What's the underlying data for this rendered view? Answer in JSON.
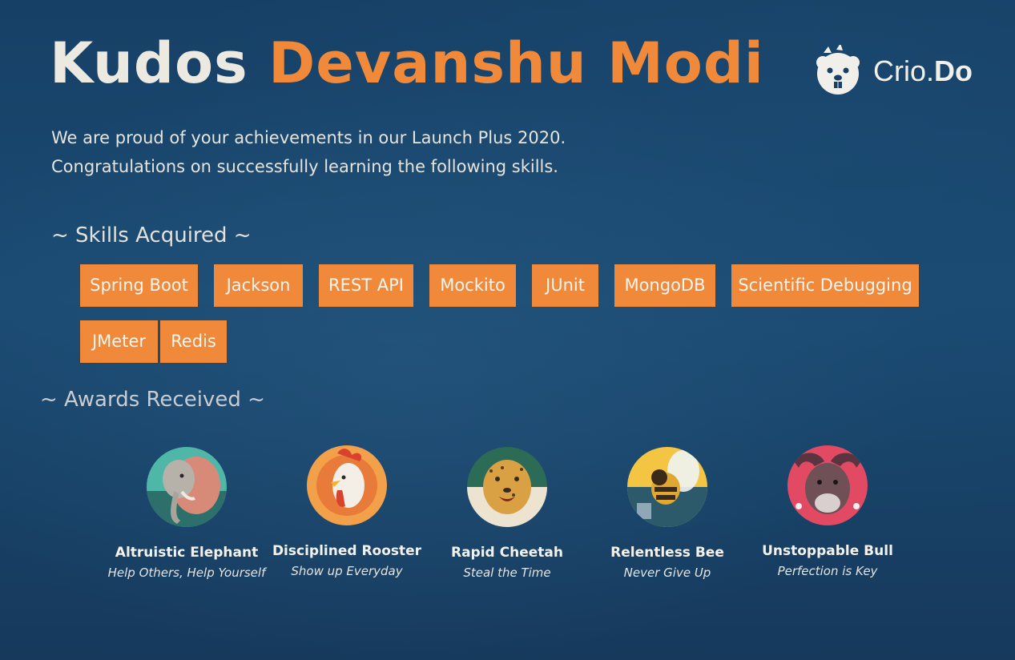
{
  "header": {
    "kudos": "Kudos",
    "name": "Devanshu Modi"
  },
  "brand": {
    "name_light": "Crio.",
    "name_bold": "Do",
    "logo_icon": "beaver-mascot-icon"
  },
  "intro": {
    "line1": "We are proud of your achievements in our Launch Plus 2020.",
    "line2": "Congratulations on successfully learning the following skills."
  },
  "skills": {
    "heading": "~ Skills Acquired ~",
    "items": [
      "Spring Boot",
      "Jackson",
      "REST API",
      "Mockito",
      "JUnit",
      "MongoDB",
      "Scientific Debugging",
      "JMeter",
      "Redis"
    ]
  },
  "awards": {
    "heading": "~ Awards Received ~",
    "items": [
      {
        "name": "Altruistic Elephant",
        "motto": "Help Others, Help Yourself",
        "icon": "elephant-icon"
      },
      {
        "name": "Disciplined Rooster",
        "motto": "Show up Everyday",
        "icon": "rooster-icon"
      },
      {
        "name": "Rapid Cheetah",
        "motto": "Steal the Time",
        "icon": "cheetah-icon"
      },
      {
        "name": "Relentless Bee",
        "motto": "Never Give Up",
        "icon": "bee-icon"
      },
      {
        "name": "Unstoppable Bull",
        "motto": "Perfection is Key",
        "icon": "bull-icon"
      }
    ]
  },
  "colors": {
    "accent": "#f0893a",
    "background": "#1a4a72",
    "text": "#e8e6df"
  }
}
